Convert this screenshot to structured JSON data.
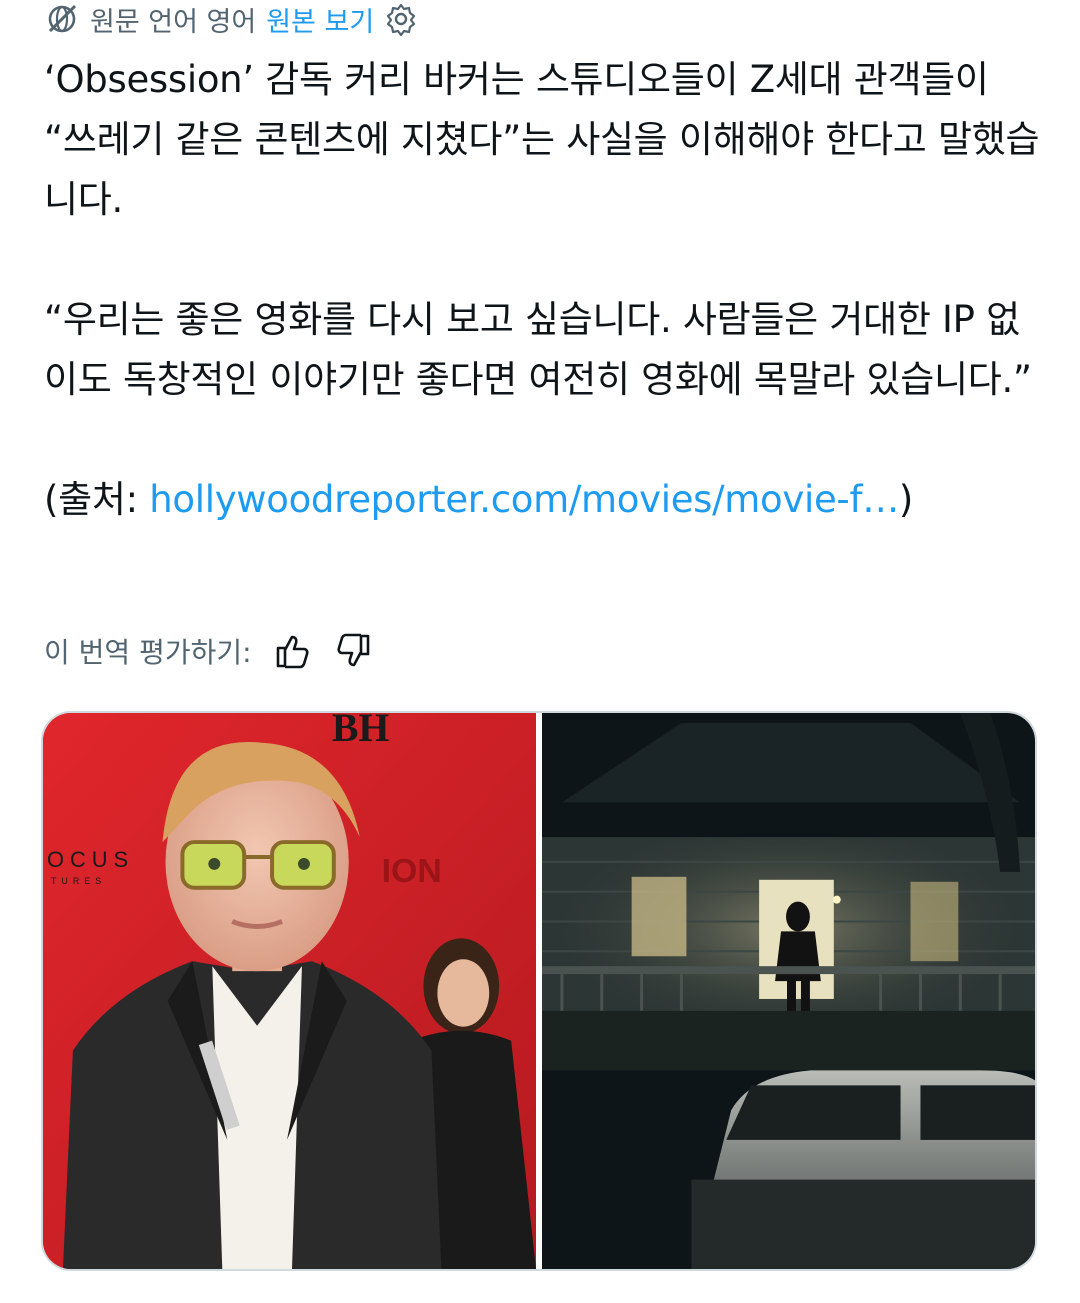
{
  "translation_bar": {
    "icon": "globe-slash-icon",
    "source_language_label": "원문 언어 영어",
    "show_original_label": "원본 보기",
    "settings_icon": "gear-icon"
  },
  "post": {
    "paragraph_1": "‘Obsession’ 감독 커리 바커는 스튜디오들이 Z세대 관객들이 “쓰레기 같은 콘텐츠에 지쳤다”는 사실을 이해해야 한다고 말했습니다.",
    "paragraph_2": "“우리는 좋은 영화를 다시 보고 싶습니다. 사람들은 거대한 IP 없이도 독창적인 이야기만 좋다면 여전히 영화에 목말라 있습니다.”",
    "source_prefix": "(출처: ",
    "source_link": "hollywoodreporter.com/movies/movie-f…",
    "source_suffix": ")"
  },
  "rating": {
    "label": "이 번역 평가하기:",
    "thumbs_up_icon": "thumbs-up-icon",
    "thumbs_down_icon": "thumbs-down-icon"
  },
  "media": {
    "images": [
      {
        "name": "photo-director-red-carpet",
        "logo_text": "BH",
        "sponsor_text": "OCUS",
        "sponsor_sub": "TURES",
        "backdrop_text": "ION"
      },
      {
        "name": "photo-house-night-scene"
      }
    ]
  },
  "colors": {
    "text": "#0f1419",
    "muted": "#536471",
    "link": "#1d9bf0",
    "border": "#cfd9de"
  }
}
